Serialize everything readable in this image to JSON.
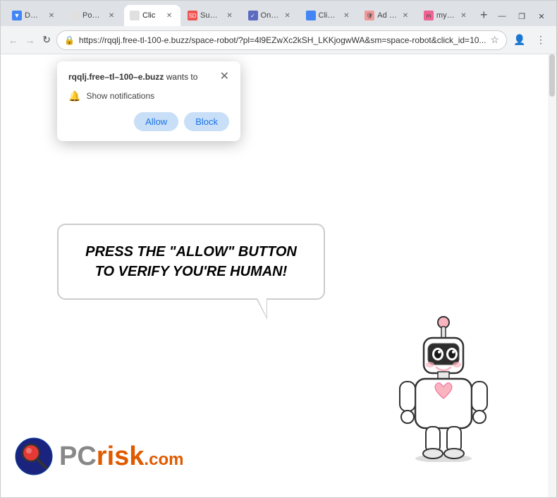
{
  "browser": {
    "tabs": [
      {
        "id": "tab-1",
        "label": "DOWN!",
        "active": false,
        "favicon_color": "#4285f4"
      },
      {
        "id": "tab-2",
        "label": "Power F...",
        "active": false,
        "favicon_color": "#e0e0e0"
      },
      {
        "id": "tab-3",
        "label": "Clic",
        "active": true,
        "favicon_color": "#e0e0e0"
      },
      {
        "id": "tab-4",
        "label": "Sugar D...",
        "active": false,
        "favicon_color": "#ef5350"
      },
      {
        "id": "tab-5",
        "label": "OneTa...",
        "active": false,
        "favicon_color": "#5c6bc0"
      },
      {
        "id": "tab-6",
        "label": "Click \"A...",
        "active": false,
        "favicon_color": "#4285f4"
      },
      {
        "id": "tab-7",
        "label": "Ad Bloc...",
        "active": false,
        "favicon_color": "#ef9a9a"
      },
      {
        "id": "tab-8",
        "label": "mysexy...",
        "active": false,
        "favicon_color": "#f06292"
      }
    ],
    "window_controls": {
      "minimize": "—",
      "restore": "❐",
      "close": "✕"
    },
    "url": "https://rqqlj.free-tl-100-e.buzz/space-robot/?pl=4l9EZwXc2kSH_LKKjogwWA&sm=space-robot&click_id=10...",
    "back_enabled": false,
    "forward_enabled": false
  },
  "notification_popup": {
    "domain": "rqqlj.free–tl–100–e.buzz",
    "wants_to": "wants to",
    "permission_text": "Show notifications",
    "allow_label": "Allow",
    "block_label": "Block"
  },
  "page": {
    "speech_bubble_text": "PRESS THE \"ALLOW\" BUTTON TO VERIFY YOU'RE HUMAN!",
    "pcrisk_text": "PC",
    "pcrisk_risk": "risk",
    "pcrisk_dotcom": ".com"
  }
}
